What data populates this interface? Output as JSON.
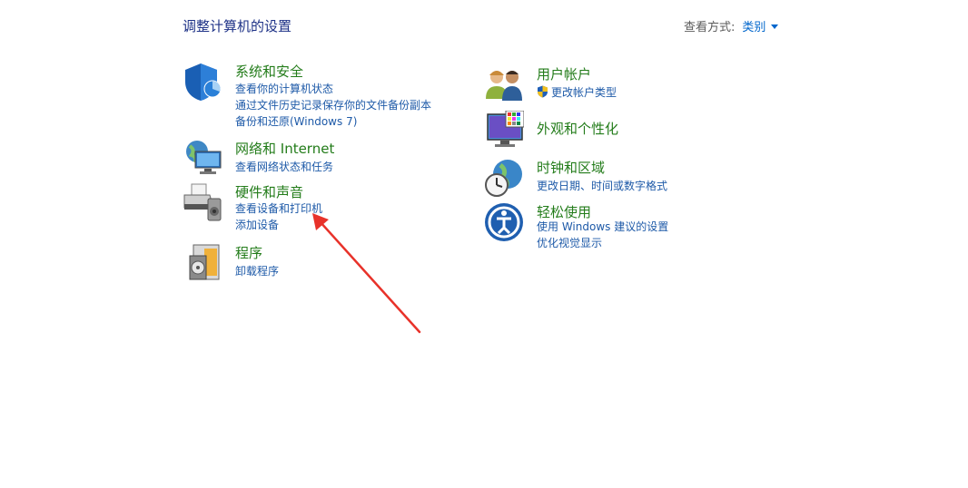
{
  "header": {
    "title": "调整计算机的设置",
    "view_by_label": "查看方式:",
    "view_by_value": "类别"
  },
  "left_categories": [
    {
      "title": "系统和安全",
      "links": [
        "查看你的计算机状态",
        "通过文件历史记录保存你的文件备份副本",
        "备份和还原(Windows 7)"
      ]
    },
    {
      "title": "网络和 Internet",
      "links": [
        "查看网络状态和任务"
      ]
    },
    {
      "title": "硬件和声音",
      "links": [
        "查看设备和打印机",
        "添加设备"
      ]
    },
    {
      "title": "程序",
      "links": [
        "卸载程序"
      ]
    }
  ],
  "right_categories": [
    {
      "title": "用户帐户",
      "links": [
        "更改帐户类型"
      ]
    },
    {
      "title": "外观和个性化",
      "links": []
    },
    {
      "title": "时钟和区域",
      "links": [
        "更改日期、时间或数字格式"
      ]
    },
    {
      "title": "轻松使用",
      "links": [
        "使用 Windows 建议的设置",
        "优化视觉显示"
      ]
    }
  ],
  "colors": {
    "category_title": "#237c1a",
    "link": "#1e5aa8",
    "page_title": "#1e3287",
    "annotation_arrow": "#e8322a"
  }
}
